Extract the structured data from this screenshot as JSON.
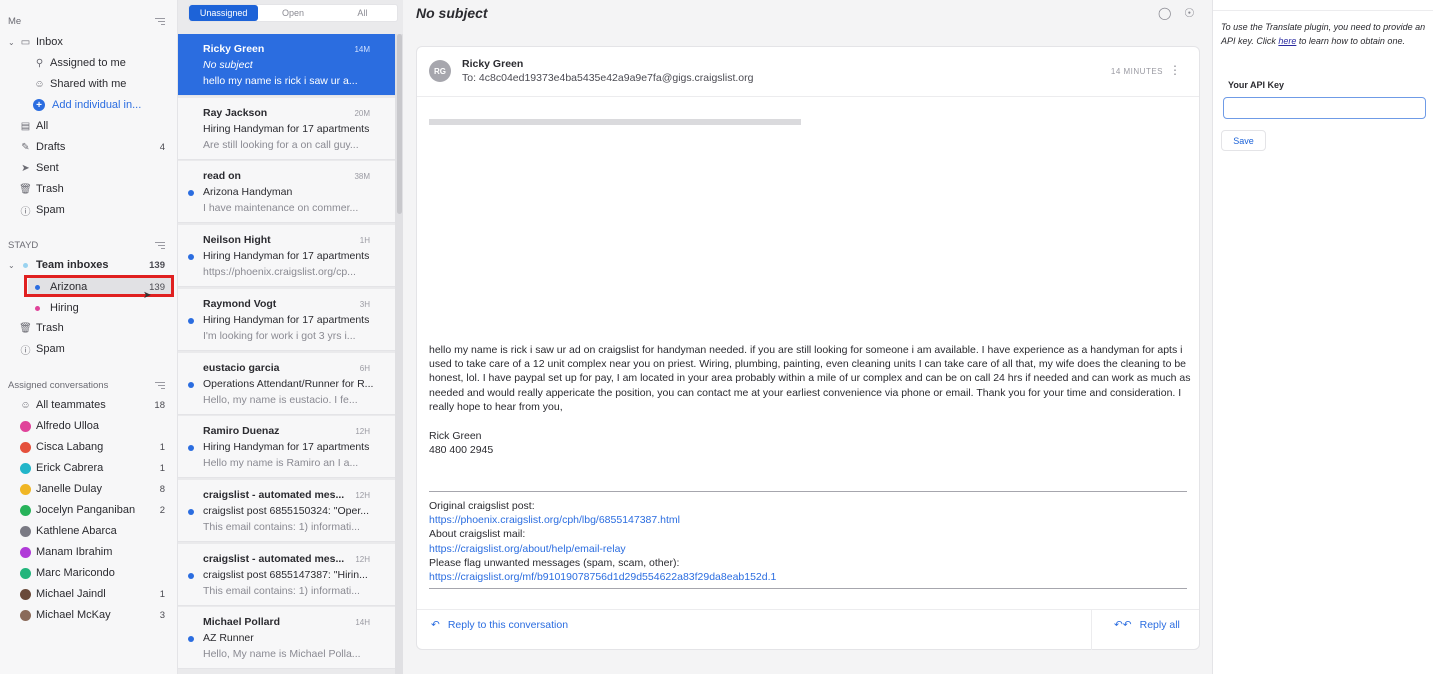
{
  "sidebar": {
    "me_header": "Me",
    "inbox": "Inbox",
    "assigned_to_me": "Assigned to me",
    "shared_with_me": "Shared with me",
    "add_individual": "Add individual in...",
    "all": "All",
    "drafts": "Drafts",
    "drafts_count": "4",
    "sent": "Sent",
    "trash": "Trash",
    "spam": "Spam",
    "stayd_header": "STAYD",
    "team_inboxes": "Team inboxes",
    "team_inboxes_count": "139",
    "arizona": "Arizona",
    "arizona_count": "139",
    "hiring": "Hiring",
    "team_trash": "Trash",
    "team_spam": "Spam",
    "assigned_header": "Assigned conversations",
    "all_teammates": "All teammates",
    "all_teammates_count": "18",
    "teammates": [
      {
        "name": "Alfredo Ulloa",
        "count": "",
        "color": "#e0439a"
      },
      {
        "name": "Cisca Labang",
        "count": "1",
        "color": "#e5503c"
      },
      {
        "name": "Erick Cabrera",
        "count": "1",
        "color": "#22b5c9"
      },
      {
        "name": "Janelle Dulay",
        "count": "8",
        "color": "#f0b624"
      },
      {
        "name": "Jocelyn Panganiban",
        "count": "2",
        "color": "#27b35a"
      },
      {
        "name": "Kathlene Abarca",
        "count": "",
        "color": "#7a7a84"
      },
      {
        "name": "Manam Ibrahim",
        "count": "",
        "color": "#b03ad8"
      },
      {
        "name": "Marc Maricondo",
        "count": "",
        "color": "#22b57c"
      },
      {
        "name": "Michael Jaindl",
        "count": "1",
        "color": "#6a4a3a"
      },
      {
        "name": "Michael McKay",
        "count": "3",
        "color": "#8a6a5a"
      }
    ]
  },
  "convlist": {
    "tabs": [
      "Unassigned",
      "Open",
      "All"
    ],
    "items": [
      {
        "from": "Ricky Green",
        "time": "14M",
        "subject": "No subject",
        "preview": "hello my name is rick i saw ur a...",
        "unread": false,
        "selected": true
      },
      {
        "from": "Ray Jackson",
        "time": "20M",
        "subject": "Hiring Handyman for 17 apartments",
        "preview": "Are still looking for a on call guy...",
        "unread": false,
        "selected": false
      },
      {
        "from": "read on",
        "time": "38M",
        "subject": "Arizona Handyman",
        "preview": "I have maintenance on commer...",
        "unread": true,
        "selected": false
      },
      {
        "from": "Neilson Hight",
        "time": "1H",
        "subject": "Hiring Handyman for 17 apartments",
        "preview": "https://phoenix.craigslist.org/cp...",
        "unread": true,
        "selected": false
      },
      {
        "from": "Raymond Vogt",
        "time": "3H",
        "subject": "Hiring Handyman for 17 apartments",
        "preview": "I'm looking for work i got 3 yrs i...",
        "unread": true,
        "selected": false
      },
      {
        "from": "eustacio garcia",
        "time": "6H",
        "subject": "Operations Attendant/Runner for R...",
        "preview": "Hello, my name is eustacio. I fe...",
        "unread": true,
        "selected": false
      },
      {
        "from": "Ramiro Duenaz",
        "time": "12H",
        "subject": "Hiring Handyman for 17 apartments",
        "preview": "Hello my name is Ramiro an I a...",
        "unread": true,
        "selected": false
      },
      {
        "from": "craigslist - automated mes...",
        "time": "12H",
        "subject": "craigslist post 6855150324: \"Oper...",
        "preview": "This email contains: 1) informati...",
        "unread": true,
        "selected": false
      },
      {
        "from": "craigslist - automated mes...",
        "time": "12H",
        "subject": "craigslist post 6855147387: \"Hirin...",
        "preview": "This email contains: 1) informati...",
        "unread": true,
        "selected": false
      },
      {
        "from": "Michael Pollard",
        "time": "14H",
        "subject": "AZ Runner",
        "preview": "Hello, My name is Michael Polla...",
        "unread": true,
        "selected": false
      }
    ]
  },
  "main": {
    "title": "No subject",
    "avatar_initials": "RG",
    "sender": "Ricky Green",
    "to": "To: 4c8c04ed19373e4ba5435e42a9a9e7fa@gigs.craigslist.org",
    "time": "14 MINUTES",
    "body": "hello my name is rick i saw ur ad on craigslist for handyman needed. if you are still  looking for someone i am available. I have experience as a handyman for apts i used to take care of a 12 unit complex near you on priest. Wiring, plumbing, painting, even cleaning units I can take care of all that, my wife does the cleaning to be honest, lol. I have paypal set up for pay, I am located in your area probably within a mile of ur complex and can be on call 24 hrs if needed and can work as much as needed and would really appericate the position, you can contact me at your earliest convenience via phone or email. Thank you for your time and consideration. I really hope to hear from you,",
    "sig_name": "Rick Green",
    "sig_phone": "480 400 2945",
    "orig_label": "Original craigslist post:",
    "orig_link": "https://phoenix.craigslist.org/cph/lbg/6855147387.html",
    "about_label": "About craigslist mail:",
    "about_link": "https://craigslist.org/about/help/email-relay",
    "flag_label": "Please flag unwanted messages (spam, scam, other):",
    "flag_link": "https://craigslist.org/mf/b91019078756d1d29d554622a83f29da8eab152d.1",
    "reply": "Reply to this conversation",
    "reply_all": "Reply all"
  },
  "plugin": {
    "text_before": "To use the Translate plugin, you need to provide an API key. Click ",
    "link": "here",
    "text_after": " to learn how to obtain one.",
    "api_label": "Your API Key",
    "api_value": "",
    "save": "Save"
  },
  "colors": {
    "accent": "#1d63d8",
    "selected_row": "#2b6de0",
    "highlight": "#e02020"
  }
}
